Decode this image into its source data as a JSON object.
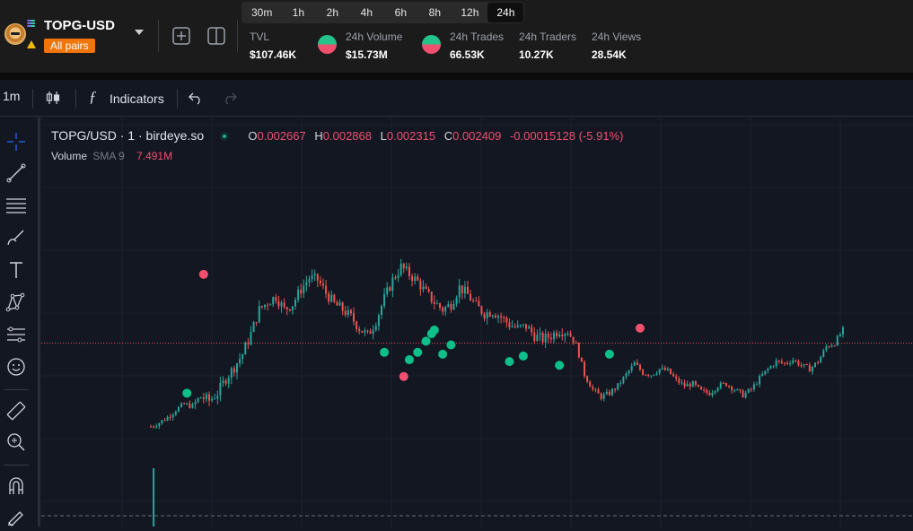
{
  "header": {
    "pair_name": "TOPG-USD",
    "pair_filter": "All pairs",
    "timeframes": [
      "30m",
      "1h",
      "2h",
      "4h",
      "6h",
      "8h",
      "12h",
      "24h"
    ],
    "active_timeframe": "24h",
    "stats": [
      {
        "label": "TVL",
        "value": "$107.46K"
      },
      {
        "label": "24h Volume",
        "value": "$15.73M"
      },
      {
        "label": "24h Trades",
        "value": "66.53K"
      },
      {
        "label": "24h Traders",
        "value": "10.27K"
      },
      {
        "label": "24h Views",
        "value": "28.54K"
      }
    ]
  },
  "toolbar": {
    "interval": "1m",
    "indicators_label": "Indicators"
  },
  "legend": {
    "title": "TOPG/USD · 1 · birdeye.so",
    "open_key": "O",
    "open": "0.002667",
    "high_key": "H",
    "high": "0.002868",
    "low_key": "L",
    "low": "0.002315",
    "close_key": "C",
    "close": "0.002409",
    "change": "-0.00015128 (-5.91%)",
    "volume_label": "Volume",
    "volume_sma": "SMA 9",
    "volume_value": "7.491M"
  },
  "colors": {
    "up": "#26a69a",
    "down": "#ef5350",
    "marker_buy": "#0fbf8a",
    "marker_sell": "#f0506e",
    "background": "#131722"
  },
  "left_tools": [
    "crosshair-icon",
    "trendline-icon",
    "fib-icon",
    "brush-icon",
    "text-icon",
    "pattern-icon",
    "forecast-icon",
    "emoji-icon",
    "ruler-icon",
    "zoom-icon",
    "magnet-icon",
    "lock-draw-icon"
  ],
  "chart_data": {
    "type": "candlestick",
    "price_line": 0.002409,
    "points": [
      [
        0,
        0.00196
      ],
      [
        3,
        0.00198
      ],
      [
        6,
        0.00201
      ],
      [
        9,
        0.00205
      ],
      [
        12,
        0.00208
      ],
      [
        15,
        0.00207
      ],
      [
        18,
        0.00212
      ],
      [
        21,
        0.0021
      ],
      [
        24,
        0.00214
      ],
      [
        27,
        0.00222
      ],
      [
        30,
        0.00228
      ],
      [
        33,
        0.00235
      ],
      [
        36,
        0.00246
      ],
      [
        39,
        0.00259
      ],
      [
        42,
        0.00263
      ],
      [
        45,
        0.00266
      ],
      [
        48,
        0.00259
      ],
      [
        51,
        0.00262
      ],
      [
        54,
        0.0027
      ],
      [
        57,
        0.00276
      ],
      [
        60,
        0.00275
      ],
      [
        63,
        0.00268
      ],
      [
        66,
        0.00262
      ],
      [
        69,
        0.00259
      ],
      [
        72,
        0.00255
      ],
      [
        75,
        0.00249
      ],
      [
        78,
        0.00245
      ],
      [
        81,
        0.00253
      ],
      [
        84,
        0.00265
      ],
      [
        87,
        0.00275
      ],
      [
        90,
        0.00282
      ],
      [
        93,
        0.00278
      ],
      [
        96,
        0.00274
      ],
      [
        99,
        0.00268
      ],
      [
        102,
        0.00263
      ],
      [
        105,
        0.00259
      ],
      [
        108,
        0.00262
      ],
      [
        111,
        0.00271
      ],
      [
        114,
        0.00267
      ],
      [
        117,
        0.00261
      ],
      [
        120,
        0.00257
      ],
      [
        123,
        0.00258
      ],
      [
        126,
        0.00255
      ],
      [
        129,
        0.00251
      ],
      [
        132,
        0.00249
      ],
      [
        135,
        0.0025
      ],
      [
        138,
        0.00245
      ],
      [
        141,
        0.00243
      ],
      [
        144,
        0.00245
      ],
      [
        147,
        0.00248
      ],
      [
        150,
        0.00247
      ],
      [
        153,
        0.0024
      ],
      [
        156,
        0.00224
      ],
      [
        159,
        0.00216
      ],
      [
        162,
        0.00212
      ],
      [
        165,
        0.00214
      ],
      [
        168,
        0.00218
      ],
      [
        171,
        0.00224
      ],
      [
        174,
        0.0023
      ],
      [
        177,
        0.00225
      ],
      [
        180,
        0.00224
      ],
      [
        183,
        0.00227
      ],
      [
        186,
        0.00226
      ],
      [
        189,
        0.00221
      ],
      [
        192,
        0.00218
      ],
      [
        195,
        0.00219
      ],
      [
        198,
        0.00215
      ],
      [
        201,
        0.00214
      ],
      [
        204,
        0.00218
      ],
      [
        207,
        0.00219
      ],
      [
        210,
        0.00216
      ],
      [
        213,
        0.00213
      ],
      [
        216,
        0.00216
      ],
      [
        219,
        0.00222
      ],
      [
        222,
        0.00227
      ],
      [
        225,
        0.00231
      ],
      [
        228,
        0.0023
      ],
      [
        231,
        0.00232
      ],
      [
        234,
        0.00229
      ],
      [
        237,
        0.00227
      ],
      [
        240,
        0.00231
      ],
      [
        243,
        0.00239
      ],
      [
        246,
        0.00241
      ],
      [
        249,
        0.00248
      ]
    ],
    "buy_markers": [
      [
        13,
        0.00214
      ],
      [
        84,
        0.00236
      ],
      [
        93,
        0.00232
      ],
      [
        96,
        0.00236
      ],
      [
        99,
        0.00242
      ],
      [
        101,
        0.00246
      ],
      [
        102,
        0.00248
      ],
      [
        105,
        0.00235
      ],
      [
        108,
        0.0024
      ],
      [
        129,
        0.00231
      ],
      [
        134,
        0.00234
      ],
      [
        147,
        0.00229
      ],
      [
        165,
        0.00235
      ]
    ],
    "sell_markers": [
      [
        19,
        0.00278
      ],
      [
        91,
        0.00223
      ],
      [
        176,
        0.00249
      ]
    ],
    "volume_spike_index": 1
  }
}
